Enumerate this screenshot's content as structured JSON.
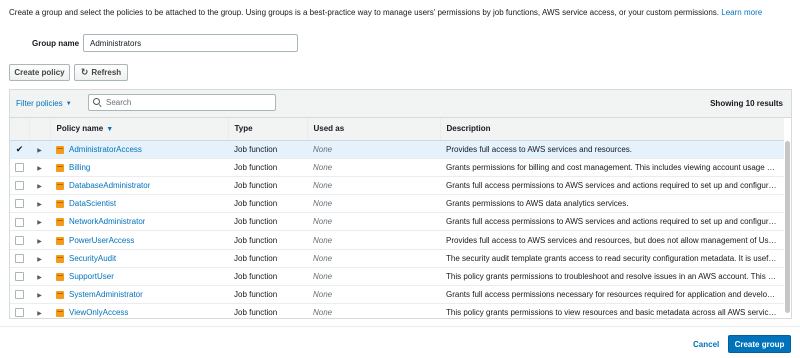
{
  "intro": {
    "text": "Create a group and select the policies to be attached to the group. Using groups is a best-practice way to manage users' permissions by job functions, AWS service access, or your custom permissions.",
    "learn_more": "Learn more"
  },
  "group": {
    "label": "Group name",
    "value": "Administrators"
  },
  "toolbar": {
    "create_policy_label": "Create policy",
    "refresh_label": "Refresh"
  },
  "filter": {
    "filter_label": "Filter policies",
    "search_placeholder": "Search",
    "showing": "Showing 10 results"
  },
  "table": {
    "columns": {
      "name": "Policy name",
      "type": "Type",
      "used_as": "Used as",
      "description": "Description"
    },
    "rows": [
      {
        "name": "AdministratorAccess",
        "type": "Job function",
        "used_as": "None",
        "description": "Provides full access to AWS services and resources.",
        "selected": true
      },
      {
        "name": "Billing",
        "type": "Job function",
        "used_as": "None",
        "description": "Grants permissions for billing and cost management. This includes viewing account usage and vi...",
        "selected": false
      },
      {
        "name": "DatabaseAdministrator",
        "type": "Job function",
        "used_as": "None",
        "description": "Grants full access permissions to AWS services and actions required to set up and configure AW...",
        "selected": false
      },
      {
        "name": "DataScientist",
        "type": "Job function",
        "used_as": "None",
        "description": "Grants permissions to AWS data analytics services.",
        "selected": false
      },
      {
        "name": "NetworkAdministrator",
        "type": "Job function",
        "used_as": "None",
        "description": "Grants full access permissions to AWS services and actions required to set up and configure AW...",
        "selected": false
      },
      {
        "name": "PowerUserAccess",
        "type": "Job function",
        "used_as": "None",
        "description": "Provides full access to AWS services and resources, but does not allow management of Users an...",
        "selected": false
      },
      {
        "name": "SecurityAudit",
        "type": "Job function",
        "used_as": "None",
        "description": "The security audit template grants access to read security configuration metadata. It is useful for ...",
        "selected": false
      },
      {
        "name": "SupportUser",
        "type": "Job function",
        "used_as": "None",
        "description": "This policy grants permissions to troubleshoot and resolve issues in an AWS account. This policy ...",
        "selected": false
      },
      {
        "name": "SystemAdministrator",
        "type": "Job function",
        "used_as": "None",
        "description": "Grants full access permissions necessary for resources required for application and development ...",
        "selected": false
      },
      {
        "name": "ViewOnlyAccess",
        "type": "Job function",
        "used_as": "None",
        "description": "This policy grants permissions to view resources and basic metadata across all AWS services.",
        "selected": false
      }
    ]
  },
  "footer": {
    "cancel_label": "Cancel",
    "create_group_label": "Create group"
  },
  "colors": {
    "accent": "#0073bb",
    "policy_icon": "#f59b1c",
    "selected_row": "#e5f2fb"
  },
  "icons": {
    "refresh": "refresh-icon",
    "search": "search-icon",
    "policy": "policy-box-icon",
    "expand": "expand-caret-icon",
    "sort": "sort-down-icon"
  }
}
